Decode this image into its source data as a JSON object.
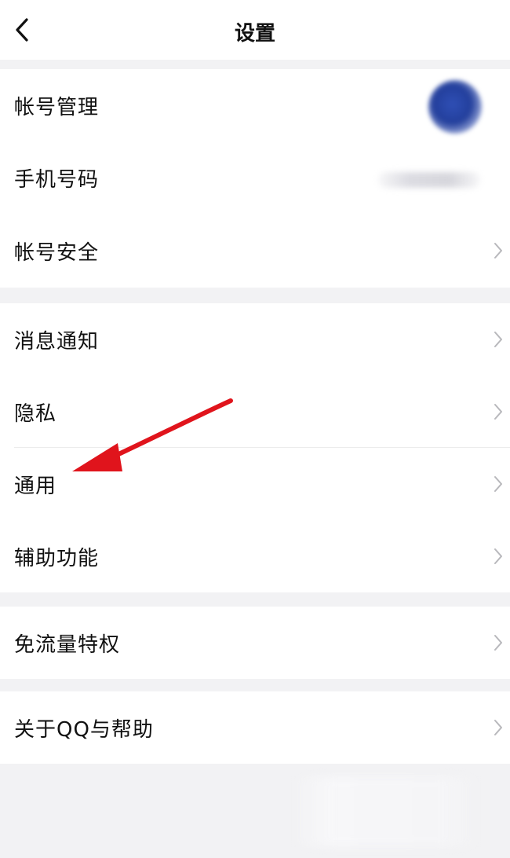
{
  "nav": {
    "title": "设置",
    "back_icon": "chevron-left-icon"
  },
  "groups": [
    {
      "items": [
        {
          "label": "帐号管理",
          "accessory": "avatar"
        },
        {
          "label": "手机号码",
          "accessory": "phone-number-blurred"
        },
        {
          "label": "帐号安全",
          "accessory": "chevron-right-icon"
        }
      ]
    },
    {
      "items": [
        {
          "label": "消息通知",
          "accessory": "chevron-right-icon"
        },
        {
          "label": "隐私",
          "accessory": "chevron-right-icon"
        },
        {
          "label": "通用",
          "accessory": "chevron-right-icon"
        },
        {
          "label": "辅助功能",
          "accessory": "chevron-right-icon"
        }
      ]
    },
    {
      "items": [
        {
          "label": "免流量特权",
          "accessory": "chevron-right-icon"
        }
      ]
    },
    {
      "items": [
        {
          "label": "关于QQ与帮助",
          "accessory": "chevron-right-icon"
        }
      ]
    }
  ],
  "annotation": {
    "arrow_color": "#e0141c",
    "points_to": "通用"
  },
  "colors": {
    "background": "#f2f2f4",
    "surface": "#ffffff",
    "chevron": "#b8b8bc",
    "avatar": "#2a47a8"
  }
}
